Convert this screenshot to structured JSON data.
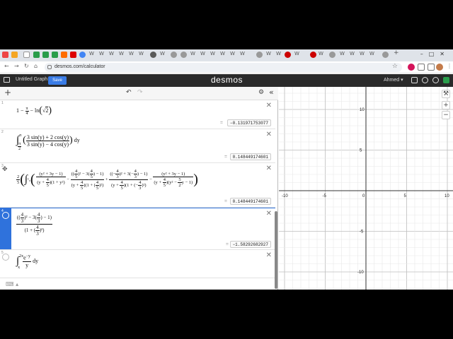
{
  "browser": {
    "url": "desmos.com/calculator",
    "tab_glyph": "W"
  },
  "header": {
    "graph_title": "Untitled Graph",
    "save_label": "Save",
    "logo": "desmos",
    "user": "Ahmed ▾"
  },
  "toolbar": {
    "add": "+",
    "undo": "↶",
    "redo": "↷",
    "settings": "⚙",
    "collapse": "«"
  },
  "expressions": [
    {
      "num": "1",
      "result": "−0.131971753077"
    },
    {
      "num": "2",
      "result": "0.148449174601"
    },
    {
      "num": "3",
      "result": "0.148449174601"
    },
    {
      "num": "4",
      "result": "−1.58292682927"
    },
    {
      "num": "5"
    }
  ],
  "graph": {
    "x_ticks": [
      "-10",
      "-5",
      "0",
      "5",
      "10"
    ],
    "y_ticks": [
      "10",
      "5",
      "-5",
      "-10"
    ],
    "zoom_in": "+",
    "zoom_out": "−",
    "wrench": "🔧"
  },
  "colors": {
    "accent": "#2f72dc",
    "header": "#2a2a2a",
    "save": "#3a7ce6"
  }
}
